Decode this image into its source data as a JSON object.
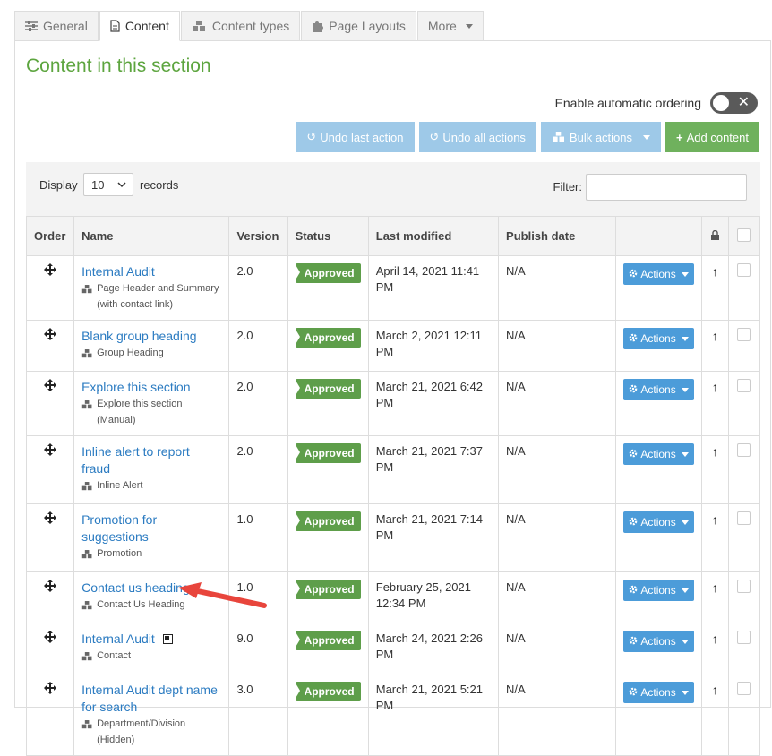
{
  "tabs": [
    {
      "label": "General",
      "icon": "sliders-icon"
    },
    {
      "label": "Content",
      "icon": "document-icon"
    },
    {
      "label": "Content types",
      "icon": "cubes-icon"
    },
    {
      "label": "Page Layouts",
      "icon": "puzzle-icon"
    },
    {
      "label": "More",
      "icon": "caret-down-icon"
    }
  ],
  "section_title": "Content in this section",
  "auto_ordering": {
    "label": "Enable automatic ordering",
    "enabled": false
  },
  "toolbar": {
    "undo_last": "Undo last action",
    "undo_all": "Undo all actions",
    "bulk_actions": "Bulk actions",
    "add_content": "Add content"
  },
  "filterbar": {
    "display_label": "Display",
    "records_value": "10",
    "records_label": "records",
    "filter_label": "Filter:",
    "filter_value": ""
  },
  "table": {
    "headers": [
      "Order",
      "Name",
      "Version",
      "Status",
      "Last modified",
      "Publish date"
    ],
    "rows": [
      {
        "name": "Internal Audit",
        "type": "Page Header and Summary (with contact link)",
        "version": "2.0",
        "status": "Approved",
        "modified": "April 14, 2021 11:41 PM",
        "publish": "N/A",
        "actions": "Actions"
      },
      {
        "name": "Blank group heading",
        "type": "Group Heading",
        "version": "2.0",
        "status": "Approved",
        "modified": "March 2, 2021 12:11 PM",
        "publish": "N/A",
        "actions": "Actions"
      },
      {
        "name": "Explore this section",
        "type": "Explore this section (Manual)",
        "version": "2.0",
        "status": "Approved",
        "modified": "March 21, 2021 6:42 PM",
        "publish": "N/A",
        "actions": "Actions"
      },
      {
        "name": "Inline alert to report fraud",
        "type": "Inline Alert",
        "version": "2.0",
        "status": "Approved",
        "modified": "March 21, 2021 7:37 PM",
        "publish": "N/A",
        "actions": "Actions"
      },
      {
        "name": "Promotion for suggestions",
        "type": "Promotion",
        "version": "1.0",
        "status": "Approved",
        "modified": "March 21, 2021 7:14 PM",
        "publish": "N/A",
        "actions": "Actions"
      },
      {
        "name": "Contact us heading",
        "type": "Contact Us Heading",
        "version": "1.0",
        "status": "Approved",
        "modified": "February 25, 2021 12:34 PM",
        "publish": "N/A",
        "actions": "Actions"
      },
      {
        "name": "Internal Audit",
        "type": "Contact",
        "version": "9.0",
        "status": "Approved",
        "modified": "March 24, 2021 2:26 PM",
        "publish": "N/A",
        "actions": "Actions"
      },
      {
        "name": "Internal Audit dept name for search",
        "type": "Department/Division (Hidden)",
        "version": "3.0",
        "status": "Approved",
        "modified": "March 21, 2021 5:21 PM",
        "publish": "N/A",
        "actions": "Actions"
      }
    ]
  },
  "colors": {
    "title_green": "#5da53f",
    "link_blue": "#2b7bc1",
    "approved_green": "#5e9e4a",
    "actions_blue": "#4c9cd9",
    "annotation_red": "#e8453c"
  }
}
